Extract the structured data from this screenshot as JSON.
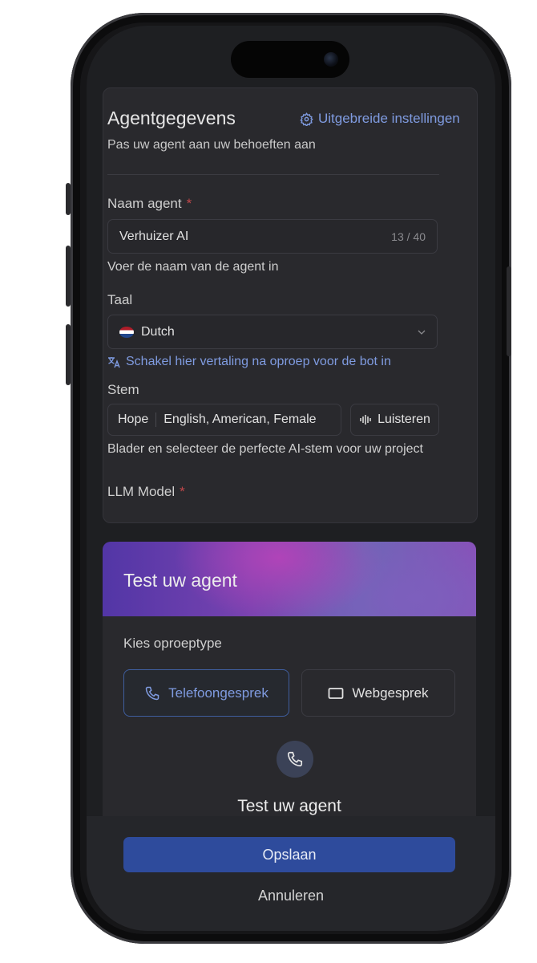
{
  "agent_details": {
    "title": "Agentgegevens",
    "advanced_settings_link": "Uitgebreide instellingen",
    "subtitle": "Pas uw agent aan uw behoeften aan",
    "name_label": "Naam agent",
    "required_mark": "*",
    "name_value": "Verhuizer AI",
    "name_counter": "13 / 40",
    "name_helper": "Voer de naam van de agent in",
    "language_label": "Taal",
    "language_value": "Dutch",
    "translation_link": "Schakel hier vertaling na oproep voor de bot in",
    "voice_label": "Stem",
    "voice_name": "Hope",
    "voice_description": "English, American, Female",
    "listen_button": "Luisteren",
    "voice_helper": "Blader en selecteer de perfecte AI-stem voor uw project",
    "llm_label": "LLM Model"
  },
  "test_agent": {
    "banner_title": "Test uw agent",
    "call_type_label": "Kies oproeptype",
    "phone_call_button": "Telefoongesprek",
    "web_call_button": "Webgesprek",
    "section_title": "Test uw agent"
  },
  "footer": {
    "save_button": "Opslaan",
    "cancel_button": "Annuleren"
  },
  "colors": {
    "accent": "#7f9be0",
    "primary_button": "#2e4b9c",
    "required": "#c0474a",
    "card_background": "#29292d"
  }
}
